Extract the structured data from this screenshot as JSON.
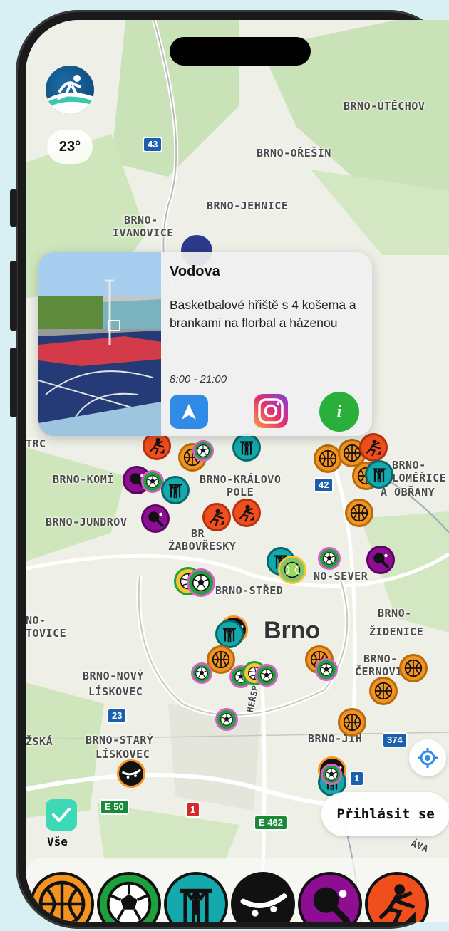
{
  "app": {
    "temperature": "23°",
    "login_label": "Přihlásit se",
    "all_label": "Vše"
  },
  "map": {
    "districts": [
      "BRNO-ÚTĚCHOV",
      "BRNO-OŘEŠÍN",
      "BRNO-JEHNICE",
      "BRNO-",
      "IVANOVICE",
      "BRNO-KOMÍ",
      "BRNO-KRÁLOVO",
      "POLE",
      "BRNO-",
      "LOMĚŘICE",
      "A OBŘANY",
      "BRNO-JUNDROV",
      "BR",
      "ŽABOVŘESKY",
      "BRNO-STŘED",
      "NO-SEVER",
      "NO-",
      "TOVICE",
      "BRNO-",
      "ŽIDENICE",
      "BRNO-",
      "ČERNOVI",
      "BRNO-NOVÝ",
      "LÍSKOVEC",
      "BRNO-STARÝ",
      "LÍSKOVEC",
      "ŽSKÁ",
      "BRNO-JIH",
      "HEŘSPICKÁ",
      "TRC",
      "ÁVA"
    ],
    "city": "Brno",
    "road_shields": [
      "43",
      "42",
      "23",
      "374",
      "E 50",
      "1",
      "E 462",
      "1"
    ]
  },
  "popup": {
    "title": "Vodova",
    "description": "Basketbalové hřiště s 4 košema a brankami na florbal a házenou",
    "hours": "8:00 - 21:00",
    "actions": {
      "navigate_icon": "navigation-arrow-icon",
      "instagram_icon": "instagram-icon",
      "info_label": "i"
    }
  },
  "categories": [
    {
      "name": "basketball",
      "color": "#f39320"
    },
    {
      "name": "soccer",
      "color": "#1ea13d"
    },
    {
      "name": "fitness",
      "color": "#13a9ad"
    },
    {
      "name": "skate",
      "color": "#111111"
    },
    {
      "name": "table-tennis",
      "color": "#8d0e92"
    },
    {
      "name": "climbing",
      "color": "#f04f1c"
    }
  ]
}
